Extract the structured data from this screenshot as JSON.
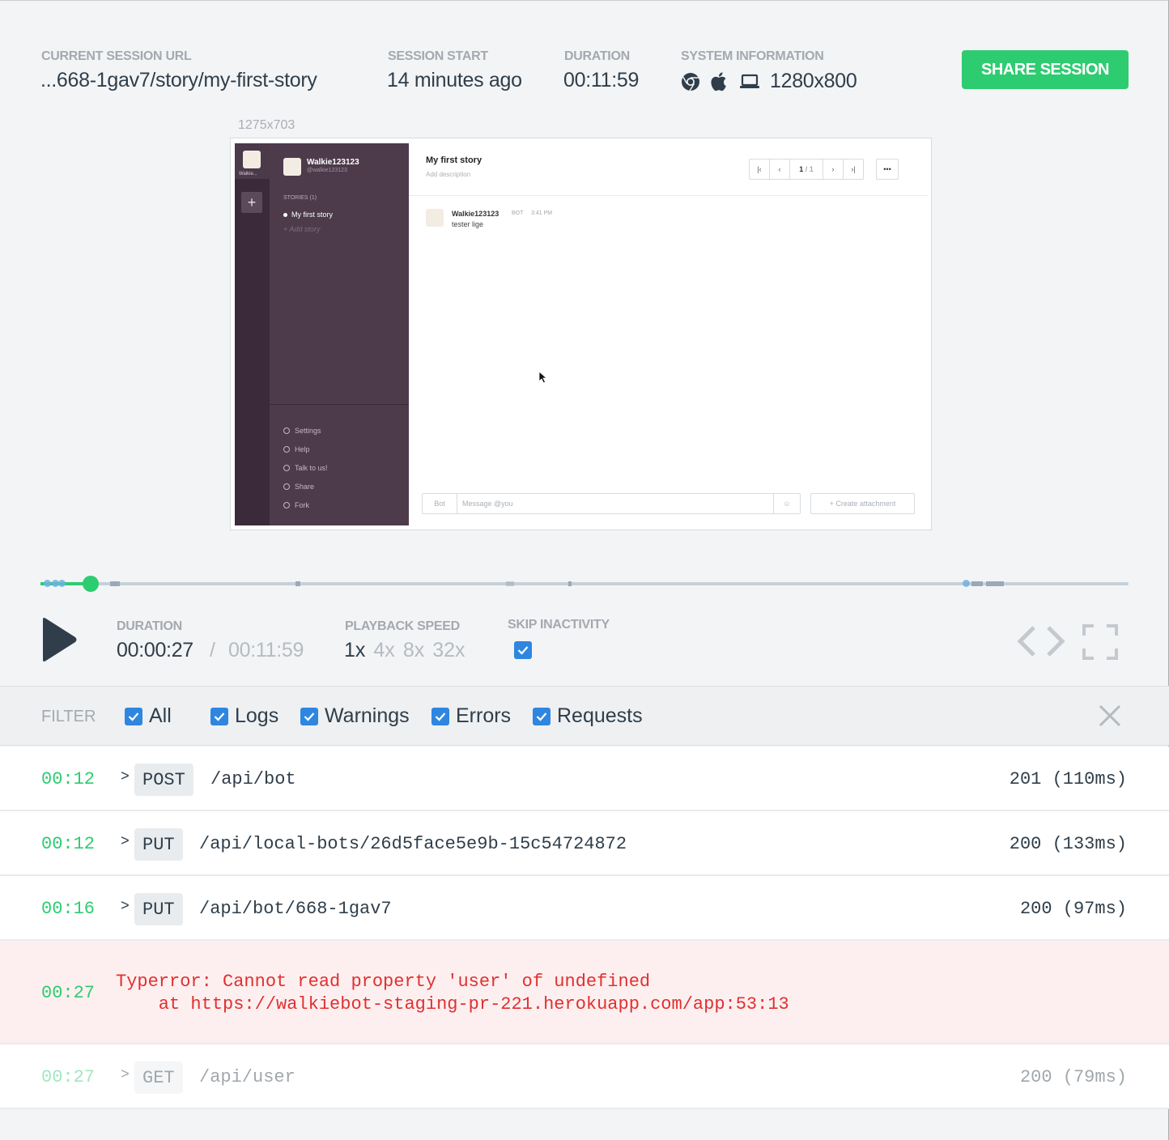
{
  "header": {
    "url_label": "CURRENT SESSION URL",
    "url_value": "...668-1gav7/story/my-first-story",
    "start_label": "SESSION START",
    "start_value": "14 minutes ago",
    "duration_label": "DURATION",
    "duration_value": "00:11:59",
    "system_label": "SYSTEM INFORMATION",
    "system_icons": [
      "chrome-icon",
      "apple-icon",
      "laptop-icon"
    ],
    "resolution": "1280x800",
    "share_label": "SHARE SESSION"
  },
  "recording": {
    "resolution_label": "1275x703",
    "rail_name": "Walkie...",
    "user_name": "Walkie123123",
    "user_handle": "@walkie123123",
    "stories_heading": "STORIES (1)",
    "story_item": "My first story",
    "add_story": "+ Add story",
    "menu": [
      "Settings",
      "Help",
      "Talk to us!",
      "Share",
      "Fork"
    ],
    "story_title": "My first story",
    "story_desc": "Add description",
    "pager_current": "1",
    "pager_total": "/ 1",
    "message_user": "Walkie123123",
    "message_badge": "BOT",
    "message_time": "3:41 PM",
    "message_text": "tester lige",
    "composer_bot": "Bot",
    "composer_placeholder": "Message @you",
    "attach_label": "+ Create attachment"
  },
  "timeline": {
    "progress": 0.046
  },
  "controls": {
    "duration_label": "DURATION",
    "current_time": "00:00:27",
    "separator": "/",
    "total_time": "00:11:59",
    "speed_label": "PLAYBACK SPEED",
    "speeds": [
      "1x",
      "4x",
      "8x",
      "32x"
    ],
    "active_speed": "1x",
    "skip_label": "SKIP INACTIVITY",
    "skip_checked": true
  },
  "filter": {
    "label": "FILTER",
    "options": [
      {
        "label": "All",
        "checked": true
      },
      {
        "label": "Logs",
        "checked": true
      },
      {
        "label": "Warnings",
        "checked": true
      },
      {
        "label": "Errors",
        "checked": true
      },
      {
        "label": "Requests",
        "checked": true
      }
    ]
  },
  "logs": [
    {
      "time": "00:12",
      "method": "POST",
      "path": "/api/bot",
      "status": "201 (110ms)"
    },
    {
      "time": "00:12",
      "method": "PUT",
      "path": "/api/local-bots/26d5face5e9b-15c54724872",
      "status": "200 (133ms)"
    },
    {
      "time": "00:16",
      "method": "PUT",
      "path": "/api/bot/668-1gav7",
      "status": "200 (97ms)"
    },
    {
      "time": "00:27",
      "error_line1": "Typerror: Cannot read property 'user' of undefined",
      "error_line2": "    at https://walkiebot-staging-pr-221.herokuapp.com/app:53:13"
    },
    {
      "time": "00:27",
      "method": "GET",
      "path": "/api/user",
      "status": "200 (79ms)"
    }
  ],
  "colors": {
    "accent_green": "#2ecc71",
    "checkbox_blue": "#2f86e0",
    "error_red": "#e03030",
    "sidebar_purple": "#4d3b4c"
  }
}
